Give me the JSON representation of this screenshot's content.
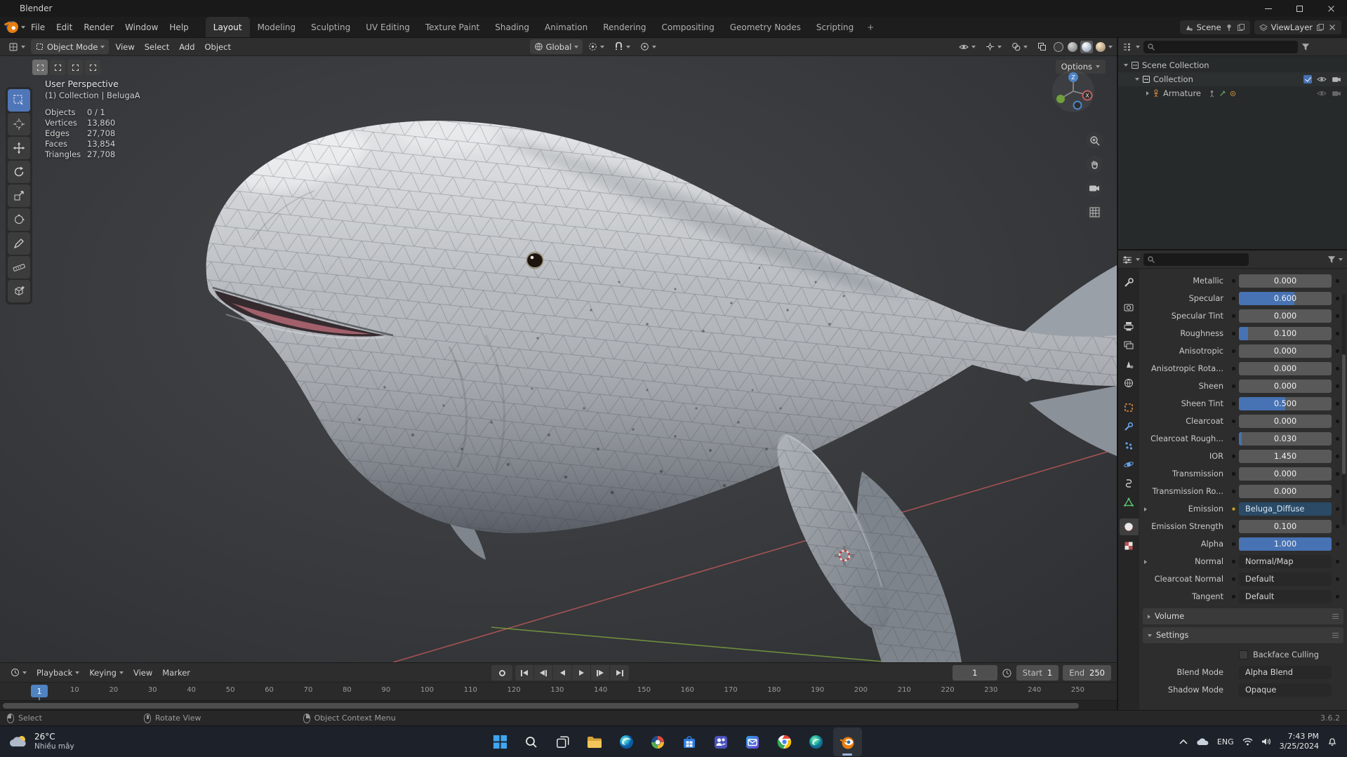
{
  "window": {
    "title": "Blender"
  },
  "topbar": {
    "menus": [
      {
        "label": "File"
      },
      {
        "label": "Edit"
      },
      {
        "label": "Render"
      },
      {
        "label": "Window"
      },
      {
        "label": "Help"
      }
    ],
    "workspaces": [
      {
        "label": "Layout",
        "active": true
      },
      {
        "label": "Modeling"
      },
      {
        "label": "Sculpting"
      },
      {
        "label": "UV Editing"
      },
      {
        "label": "Texture Paint"
      },
      {
        "label": "Shading"
      },
      {
        "label": "Animation"
      },
      {
        "label": "Rendering"
      },
      {
        "label": "Compositing"
      },
      {
        "label": "Geometry Nodes"
      },
      {
        "label": "Scripting"
      }
    ],
    "add_workspace": "+",
    "scene": "Scene",
    "viewlayer": "ViewLayer"
  },
  "viewport_header": {
    "mode": "Object Mode",
    "menus": [
      {
        "label": "View"
      },
      {
        "label": "Select"
      },
      {
        "label": "Add"
      },
      {
        "label": "Object"
      }
    ],
    "orientation": "Global",
    "options": "Options"
  },
  "viewport": {
    "perspective_label": "User Perspective",
    "context_label": "(1) Collection | BelugaA",
    "stats": [
      {
        "label": "Objects",
        "value": "0 / 1"
      },
      {
        "label": "Vertices",
        "value": "13,860"
      },
      {
        "label": "Edges",
        "value": "27,708"
      },
      {
        "label": "Faces",
        "value": "13,854"
      },
      {
        "label": "Triangles",
        "value": "27,708"
      }
    ],
    "axis_x": "X",
    "axis_z": "Z"
  },
  "outliner": {
    "tree": [
      {
        "label": "Scene Collection"
      },
      {
        "label": "Collection"
      },
      {
        "label": "Armature"
      }
    ]
  },
  "properties": {
    "sliders": [
      {
        "label": "Metallic",
        "value": "0.000",
        "fill": 0
      },
      {
        "label": "Specular",
        "value": "0.600",
        "fill": 0.6
      },
      {
        "label": "Specular Tint",
        "value": "0.000",
        "fill": 0
      },
      {
        "label": "Roughness",
        "value": "0.100",
        "fill": 0.1
      },
      {
        "label": "Anisotropic",
        "value": "0.000",
        "fill": 0
      },
      {
        "label": "Anisotropic Rota...",
        "value": "0.000",
        "fill": 0
      },
      {
        "label": "Sheen",
        "value": "0.000",
        "fill": 0
      },
      {
        "label": "Sheen Tint",
        "value": "0.500",
        "fill": 0.5
      },
      {
        "label": "Clearcoat",
        "value": "0.000",
        "fill": 0
      },
      {
        "label": "Clearcoat Rough...",
        "value": "0.030",
        "fill": 0.03
      },
      {
        "label": "IOR",
        "value": "1.450",
        "fill": 0
      },
      {
        "label": "Transmission",
        "value": "0.000",
        "fill": 0
      },
      {
        "label": "Transmission Ro...",
        "value": "0.000",
        "fill": 0
      }
    ],
    "emission": {
      "label": "Emission",
      "value": "Beluga_Diffuse"
    },
    "emission_strength": {
      "label": "Emission Strength",
      "value": "0.100",
      "fill": 0
    },
    "alpha": {
      "label": "Alpha",
      "value": "1.000",
      "fill": 1
    },
    "normal": {
      "label": "Normal",
      "value": "Normal/Map"
    },
    "clearcoat_normal": {
      "label": "Clearcoat Normal",
      "value": "Default"
    },
    "tangent": {
      "label": "Tangent",
      "value": "Default"
    },
    "volume_section": "Volume",
    "settings_section": "Settings",
    "settings": {
      "backface_culling": "Backface Culling",
      "blend_mode": {
        "label": "Blend Mode",
        "value": "Alpha Blend"
      },
      "shadow_mode": {
        "label": "Shadow Mode",
        "value": "Opaque"
      }
    }
  },
  "timeline": {
    "menus": [
      {
        "label": "Playback"
      },
      {
        "label": "Keying"
      },
      {
        "label": "View"
      },
      {
        "label": "Marker"
      }
    ],
    "frame_field": "1",
    "current_frame": "1",
    "start": {
      "label": "Start",
      "value": "1"
    },
    "end": {
      "label": "End",
      "value": "250"
    },
    "ticks": [
      "10",
      "20",
      "30",
      "40",
      "50",
      "60",
      "70",
      "80",
      "90",
      "100",
      "110",
      "120",
      "130",
      "140",
      "150",
      "160",
      "170",
      "180",
      "190",
      "200",
      "210",
      "220",
      "230",
      "240",
      "250"
    ]
  },
  "statusbar": {
    "hints": [
      {
        "button": "lmb",
        "label": "Select"
      },
      {
        "button": "mmb",
        "label": "Rotate View"
      },
      {
        "button": "rmb",
        "label": "Object Context Menu"
      }
    ],
    "version": "3.6.2"
  },
  "taskbar": {
    "weather": {
      "temp": "26°C",
      "condition": "Nhiều mây"
    },
    "tray": {
      "language": "ENG",
      "time": "7:43 PM",
      "date": "3/25/2024"
    }
  },
  "colors": {
    "accent": "#4772b3",
    "selection": "#e87d0d"
  }
}
